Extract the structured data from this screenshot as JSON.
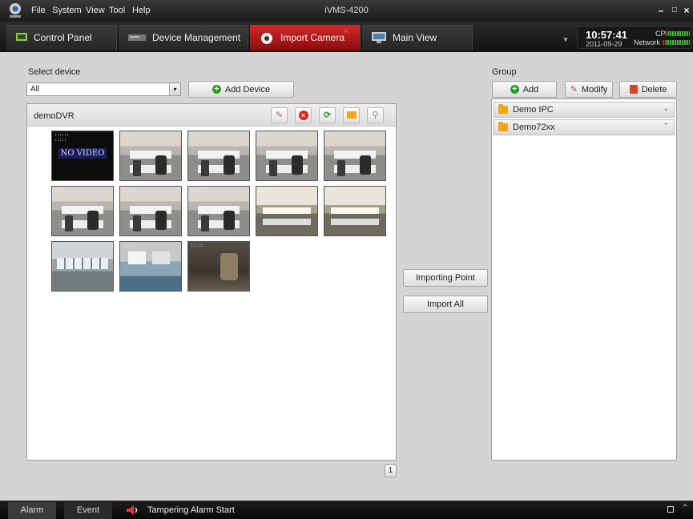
{
  "menubar": {
    "items": [
      "File",
      "System",
      "View",
      "Tool",
      "Help"
    ],
    "app_title": "iVMS-4200"
  },
  "tabs": [
    {
      "label": "Control Panel",
      "icon": "control-panel-icon"
    },
    {
      "label": "Device Management",
      "icon": "dvr-icon"
    },
    {
      "label": "Import Camera",
      "icon": "camera-icon",
      "active": true
    },
    {
      "label": "Main View",
      "icon": "monitor-icon"
    }
  ],
  "clock": {
    "time": "10:57:41",
    "date": "2011-09-29",
    "cpu_label": "CPU",
    "network_label": "Network"
  },
  "left": {
    "select_label": "Select device",
    "select_value": "All",
    "add_device_label": "Add Device",
    "device_name": "demoDVR",
    "page_number": "1"
  },
  "center": {
    "importing_point_label": "Importing Point",
    "import_all_label": "Import All"
  },
  "right": {
    "group_label": "Group",
    "add_label": "Add",
    "modify_label": "Modify",
    "delete_label": "Delete",
    "groups": [
      {
        "name": "Demo IPC",
        "chevron": "⌄"
      },
      {
        "name": "Demo72xx",
        "chevron": "⌃"
      }
    ]
  },
  "thumbs": {
    "novideo_text": "NO VIDEO"
  },
  "statusbar": {
    "alarm_label": "Alarm",
    "event_label": "Event",
    "message": "Tampering Alarm  Start"
  },
  "colors": {
    "active_tab": "#c41e1e",
    "accent_green": "#2a9d2a",
    "folder": "#f0a616"
  }
}
